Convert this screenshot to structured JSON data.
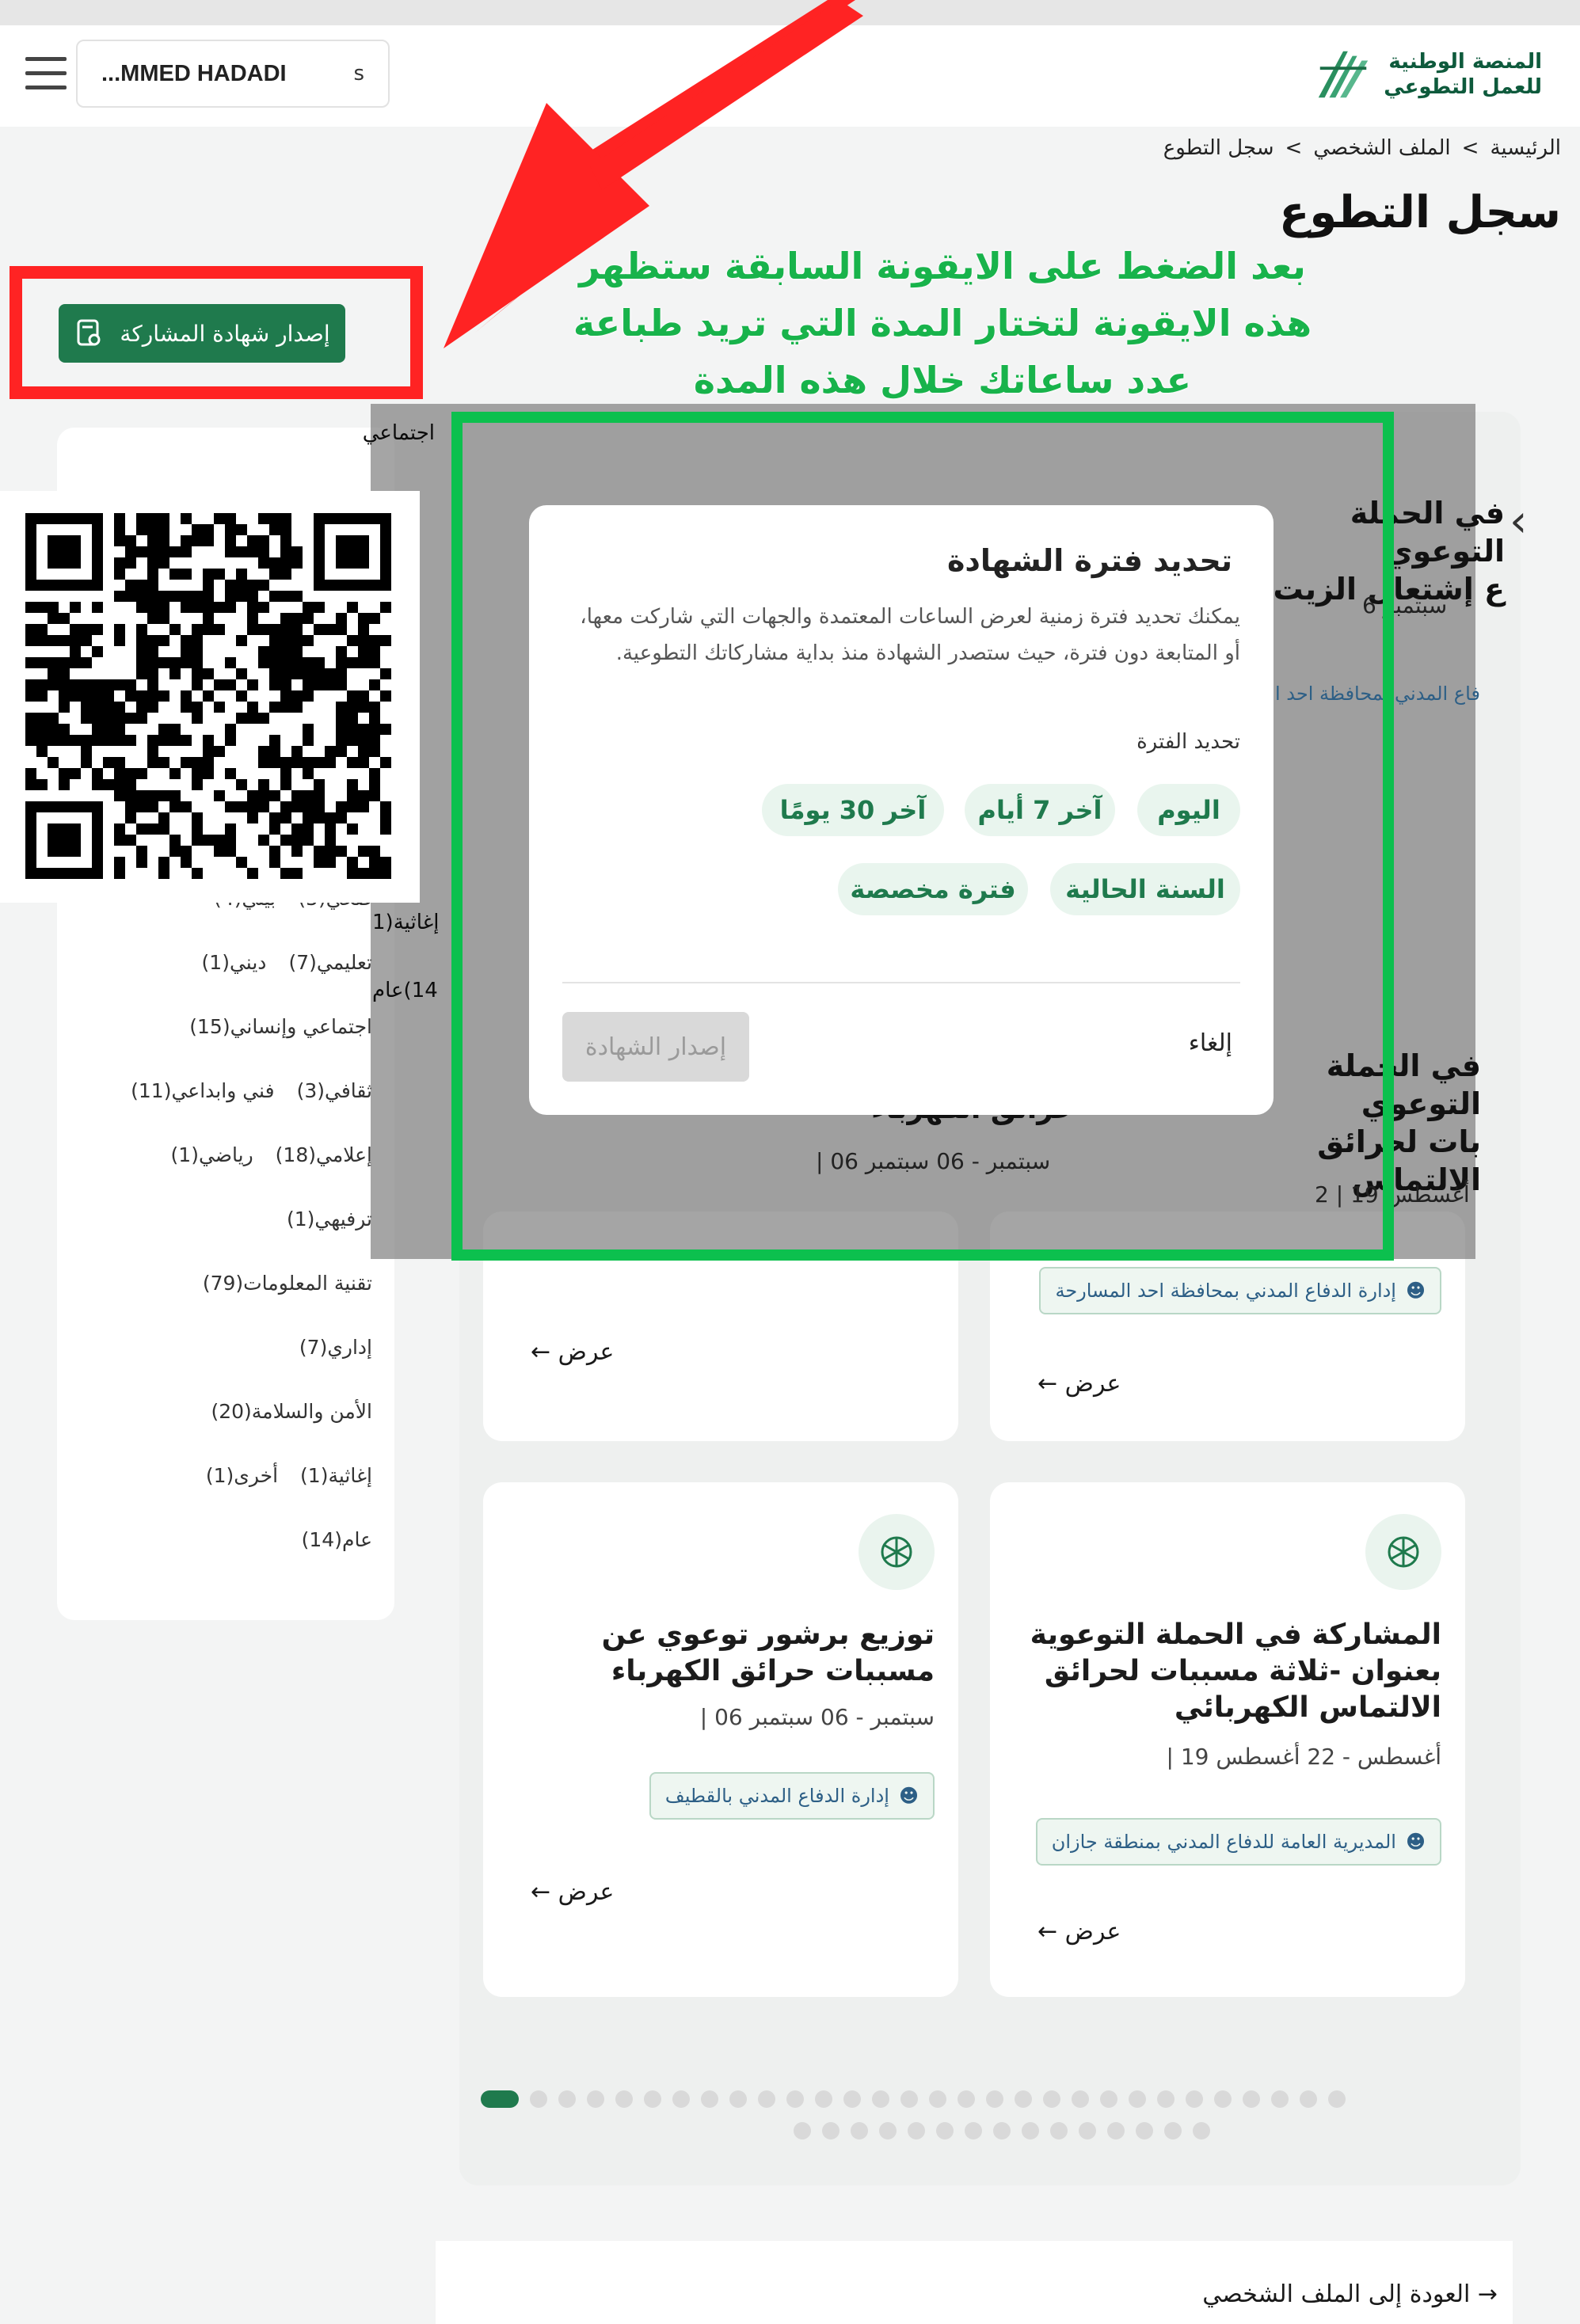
{
  "header": {
    "user_name": "...MMED HADADI",
    "user_initial": "s",
    "logo_line1": "المنصة الوطنية",
    "logo_line2": "للعمل التطوعي"
  },
  "breadcrumb": {
    "home": "الرئيسية",
    "sep1": ">",
    "profile": "الملف الشخصي",
    "sep2": ">",
    "current": "سجل التطوع"
  },
  "page_title": "سجل التطوع",
  "annotation": {
    "line1": "بعد الضغط على الايقونة السابقة ستظهر",
    "line2": "هذه الايقونة لتختار المدة التي تريد طباعة",
    "line3": "عدد ساعاتك خلال هذه المدة"
  },
  "issue_certificate_button": "إصدار شهادة المشاركة",
  "sidebar_partial": {
    "top": "اجتماعي",
    "mid_left_1": "إغاثية(1",
    "mid_left_2": "14)عام"
  },
  "filters": [
    [
      "صحي(5)",
      "بيئي(4)"
    ],
    [
      "تعليمي(7)",
      "ديني(1)"
    ],
    [
      "اجتماعي وإنساني(15)"
    ],
    [
      "ثقافي(3)",
      "فني وابداعي(11)"
    ],
    [
      "إعلامي(18)",
      "رياضي(1)"
    ],
    [
      "ترفيهي(1)"
    ],
    [
      "تقنية المعلومات(79)"
    ],
    [
      "إداري(7)"
    ],
    [
      "الأمن والسلامة(20)"
    ],
    [
      "إغاثية(1)",
      "أخرى(1)"
    ],
    [
      "عام(14)"
    ]
  ],
  "modal": {
    "title": "تحديد فترة الشهادة",
    "description": "يمكنك تحديد فترة زمنية لعرض الساعات المعتمدة والجهات التي شاركت معها، أو المتابعة دون فترة، حيث ستصدر الشهادة منذ بداية مشاركاتك التطوعية.",
    "period_label": "تحديد الفترة",
    "options": [
      "اليوم",
      "آخر 7 أيام",
      "آخر 30 يومًا",
      "السنة الحالية",
      "فترة مخصصة"
    ],
    "cancel": "إلغاء",
    "issue": "إصدار الشهادة"
  },
  "behind_overlay": {
    "card_a_title_line1": "في الحملة التوعوي",
    "card_a_title_line2": "ع إشتعال الزيت",
    "card_a_date": "سبتمبر 6",
    "card_a_tag": "فاع المدني بمحافظة احد ا",
    "card_b_title_line1": "في الحملة التوعوي",
    "card_b_title_line2": "بات لحرائق الالتماس",
    "card_b_date": "أغسطس 19 | 2",
    "card_c_title": "حرائق الكهرباء",
    "card_c_date": "سبتمبر - 06 سبتمبر 06 |"
  },
  "cards": [
    {
      "tag": "إدارة الدفاع المدني بمحافظة احد المسارحة",
      "view": "عرض ←"
    },
    {
      "view": "عرض ←"
    },
    {
      "title": "المشاركة في الحملة التوعوية بعنوان -ثلاثة مسببات لحرائق الالتماس الكهربائي",
      "date": "أغسطس - 22 أغسطس 19 |",
      "tag": "المديرية العامة للدفاع المدني بمنطقة جازان",
      "view": "عرض ←"
    },
    {
      "title": "توزيع برشور توعوي عن مسببات حرائق الكهرباء",
      "date": "سبتمبر - 06 سبتمبر 06 |",
      "tag": "إدارة الدفاع المدني بالقطيف",
      "view": "عرض ←"
    }
  ],
  "pagination": {
    "total_pages": 45,
    "current_page": 1
  },
  "back_link": "→ العودة إلى الملف الشخصي",
  "colors": {
    "brand_green": "#1f7a4d",
    "annotation_green": "#18b34b",
    "highlight_red": "#ff2323",
    "highlight_green": "#0cc04e"
  }
}
